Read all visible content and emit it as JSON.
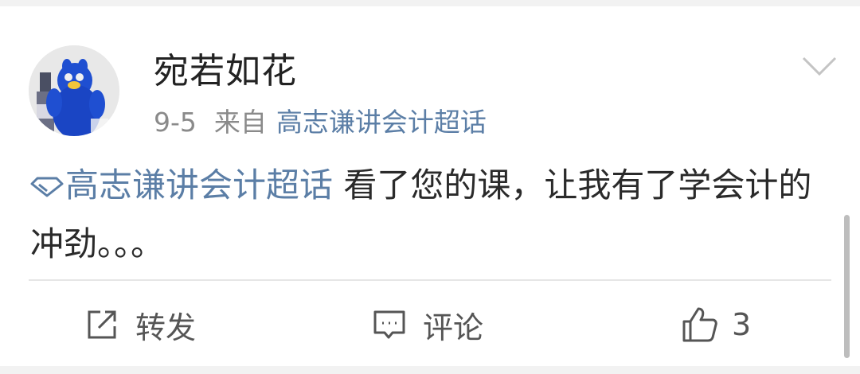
{
  "post": {
    "username": "宛若如花",
    "date": "9-5",
    "from_label": "来自",
    "source": "高志谦讲会计超话",
    "topic": "高志谦讲会计超话",
    "body_text": " 看了您的课，让我有了学会计的冲劲。。。"
  },
  "actions": {
    "repost_label": "转发",
    "comment_label": "评论",
    "like_count": "3"
  },
  "icons": {
    "avatar": "avatar-image",
    "menu": "chevron-down-icon",
    "topic": "diamond-topic-icon",
    "repost": "share-icon",
    "comment": "comment-icon",
    "like": "thumbs-up-icon"
  },
  "colors": {
    "link": "#5b7ea6",
    "text": "#2a2a2a",
    "meta": "#8a8a8a",
    "background": "#f2f2f2"
  }
}
